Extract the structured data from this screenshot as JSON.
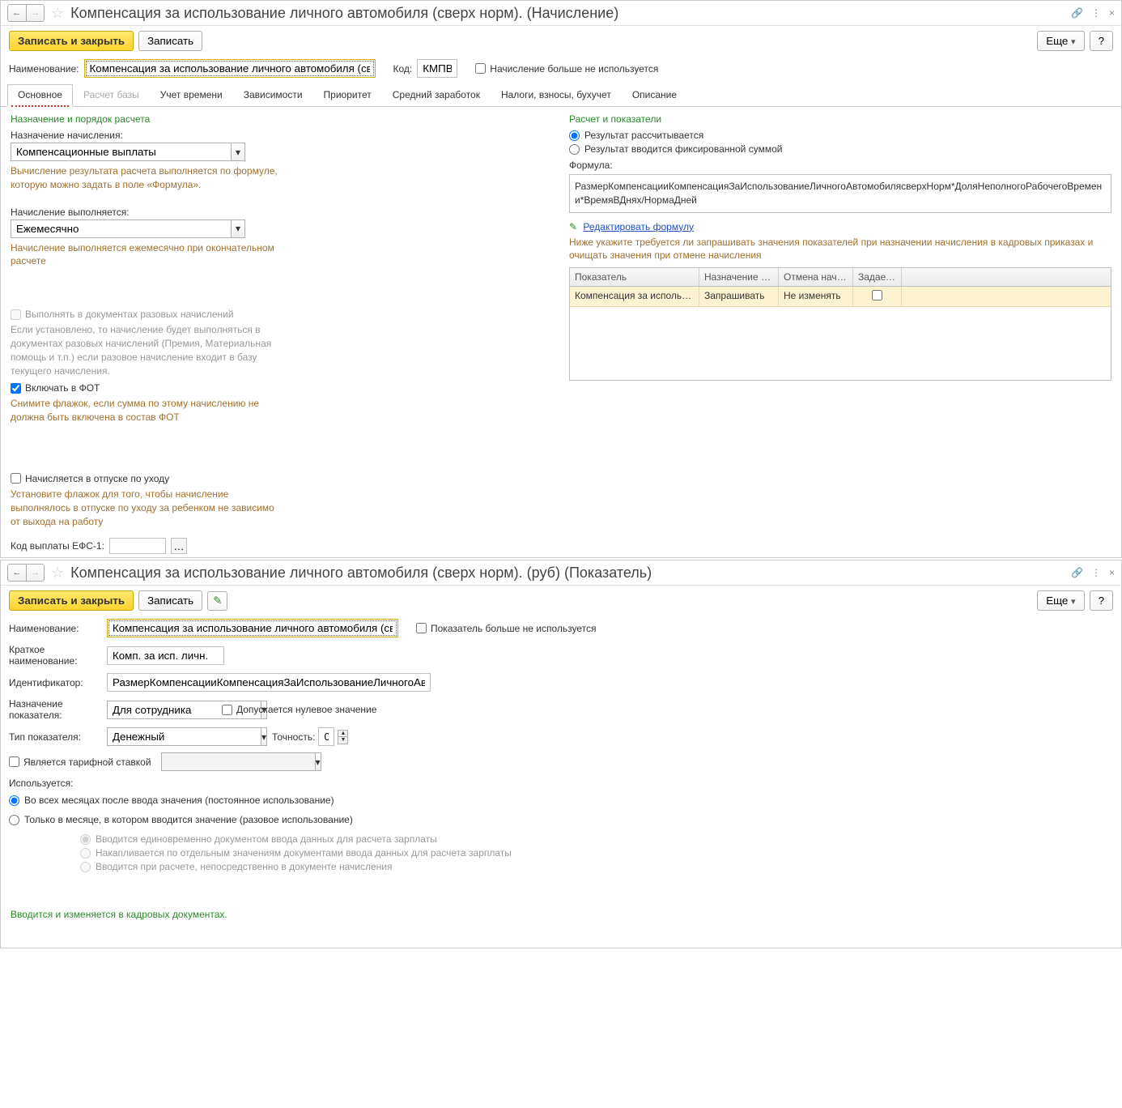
{
  "window1": {
    "title": "Компенсация за использование личного автомобиля (сверх норм). (Начисление)",
    "save_close": "Записать и закрыть",
    "save": "Записать",
    "more": "Еще",
    "help": "?",
    "name_label": "Наименование:",
    "name_value": "Компенсация за использование личного автомобиля (сверх норм).",
    "code_label": "Код:",
    "code_value": "КМПВ",
    "not_used": "Начисление больше не используется",
    "tabs": [
      "Основное",
      "Расчет базы",
      "Учет времени",
      "Зависимости",
      "Приоритет",
      "Средний заработок",
      "Налоги, взносы, бухучет",
      "Описание"
    ],
    "left": {
      "section": "Назначение и порядок расчета",
      "purpose_label": "Назначение начисления:",
      "purpose_value": "Компенсационные выплаты",
      "purpose_hint": "Вычисление результата расчета выполняется по формуле, которую можно задать в поле «Формула».",
      "exec_label": "Начисление выполняется:",
      "exec_value": "Ежемесячно",
      "exec_hint": "Начисление выполняется ежемесячно при окончательном расчете",
      "onetime_cb": "Выполнять в документах разовых начислений",
      "onetime_hint": "Если установлено, то начисление будет выполняться в документах разовых начислений (Премия, Материальная помощь и т.п.) если разовое начисление входит в базу текущего начисления.",
      "fot_cb": "Включать в ФОТ",
      "fot_hint": "Снимите флажок, если сумма по этому начислению не должна быть включена в состав ФОТ",
      "vacation_cb": "Начисляется в отпуске по уходу",
      "vacation_hint": "Установите флажок для того, чтобы начисление выполнялось в отпуске по уходу за ребенком не зависимо от выхода на работу",
      "efs_label": "Код выплаты ЕФС-1:"
    },
    "right": {
      "section": "Расчет и показатели",
      "radio1": "Результат рассчитывается",
      "radio2": "Результат вводится фиксированной суммой",
      "formula_label": "Формула:",
      "formula_value": "РазмерКомпенсацииКомпенсацияЗаИспользованиеЛичногоАвтомобилясверхНорм*ДоляНеполногоРабочегоВремени*ВремяВДнях/НормаДней",
      "edit_formula": "Редактировать формулу",
      "table_hint": "Ниже укажите требуется ли запрашивать значения показателей при назначении начисления в кадровых приказах и очищать значения при отмене начисления",
      "headers": [
        "Показатель",
        "Назначение начис...",
        "Отмена начисле...",
        "Задает бу..."
      ],
      "row": [
        "Компенсация за использовани...",
        "Запрашивать",
        "Не изменять",
        ""
      ]
    }
  },
  "window2": {
    "title": "Компенсация за использование личного автомобиля (сверх норм). (руб) (Показатель)",
    "save_close": "Записать и закрыть",
    "save": "Записать",
    "more": "Еще",
    "help": "?",
    "name_label": "Наименование:",
    "name_value": "Компенсация за использование личного автомобиля (сверх норм). (руб)",
    "not_used": "Показатель больше не используется",
    "short_label": "Краткое наименование:",
    "short_value": "Комп. за исп. личн.",
    "id_label": "Идентификатор:",
    "id_value": "РазмерКомпенсацииКомпенсацияЗаИспользованиеЛичногоАвтомобилясверхНорм",
    "purpose_label": "Назначение показателя:",
    "purpose_value": "Для сотрудника",
    "allow_zero": "Допускается нулевое значение",
    "type_label": "Тип показателя:",
    "type_value": "Денежный",
    "precision_label": "Точность:",
    "precision_value": "0",
    "tariff_cb": "Является тарифной ставкой",
    "used_label": "Используется:",
    "radio_perm": "Во всех месяцах после ввода значения (постоянное использование)",
    "radio_once": "Только в месяце, в котором вводится значение (разовое использование)",
    "sub1": "Вводится единовременно документом ввода данных для расчета зарплаты",
    "sub2": "Накапливается по отдельным значениям документами ввода данных для расчета зарплаты",
    "sub3": "Вводится при расчете, непосредственно в документе начисления",
    "green_note": "Вводится и изменяется в кадровых документах."
  }
}
